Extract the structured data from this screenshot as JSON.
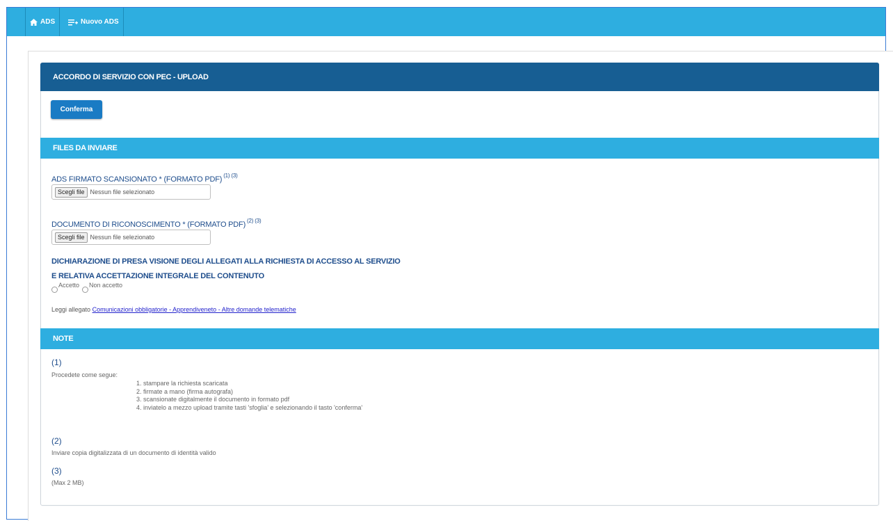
{
  "nav": {
    "home_label": "ADS",
    "new_label": "Nuovo ADS"
  },
  "card": {
    "title": "ACCORDO DI SERVIZIO CON PEC - UPLOAD",
    "confirm_label": "Conferma"
  },
  "files_section": {
    "title": "FILES DA INVIARE",
    "ads_label": "ADS FIRMATO SCANSIONATO * (FORMATO PDF)",
    "ads_refs": "(1) (3)",
    "doc_label": "DOCUMENTO DI RICONOSCIMENTO * (FORMATO PDF)",
    "doc_refs": "(2) (3)",
    "file_button": "Scegli file",
    "file_placeholder": "Nessun file selezionato",
    "declaration_line1": "DICHIARAZIONE DI PRESA VISIONE DEGLI ALLEGATI ALLA RICHIESTA DI ACCESSO AL SERVIZIO",
    "declaration_line2": "E RELATIVA ACCETTAZIONE INTEGRALE DEL CONTENUTO",
    "accept_label": "Accetto",
    "reject_label": "Non accetto",
    "read_attachment_prefix": "Leggi allegato",
    "attachment_link": "Comunicazioni obbligatorie - Apprendiveneto - Altre domande telematiche"
  },
  "notes_section": {
    "title": "NOTE",
    "note1_num": "(1)",
    "note1_intro": "Procedete come segue:",
    "note1_steps": [
      "1. stampare la richiesta scaricata",
      "2. firmate a mano (firma autografa)",
      "3. scansionate digitalmente il documento in formato pdf",
      "4. inviatelo a mezzo upload tramite tasti 'sfoglia' e selezionando il tasto 'conferma'"
    ],
    "note2_num": "(2)",
    "note2_text": "Inviare copia digitalizzata di un documento di identità valido",
    "note3_num": "(3)",
    "note3_text": "(Max 2 MB)"
  },
  "colors": {
    "topbar": "#2eaee0",
    "header": "#175e93",
    "button": "#1a7bc4",
    "label": "#1e4d8c"
  }
}
